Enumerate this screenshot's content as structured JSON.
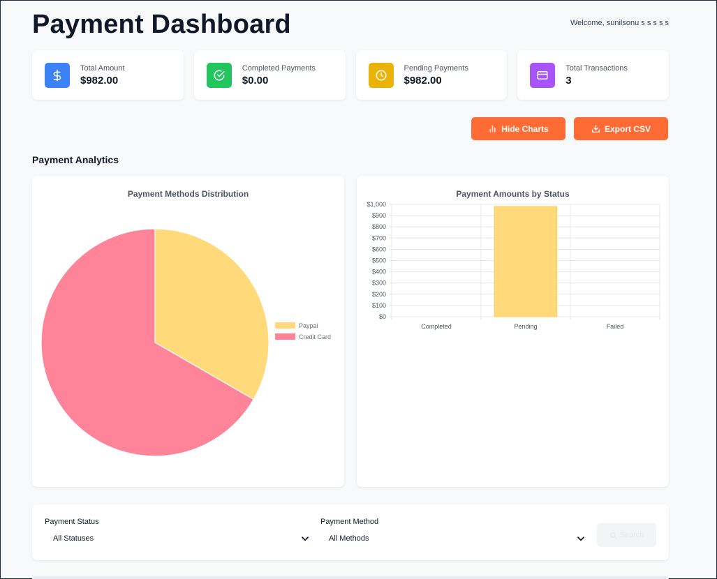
{
  "header": {
    "title": "Payment Dashboard",
    "welcome": "Welcome, sunilsonu s s s s s"
  },
  "stats": [
    {
      "label": "Total Amount",
      "value": "$982.00",
      "icon": "dollar-icon",
      "color": "#3b82f6"
    },
    {
      "label": "Completed Payments",
      "value": "$0.00",
      "icon": "check-circle-icon",
      "color": "#22c55e"
    },
    {
      "label": "Pending Payments",
      "value": "$982.00",
      "icon": "clock-icon",
      "color": "#eab308"
    },
    {
      "label": "Total Transactions",
      "value": "3",
      "icon": "credit-card-icon",
      "color": "#a855f7"
    }
  ],
  "actions": {
    "hide_charts": "Hide Charts",
    "export_csv": "Export CSV",
    "accent": "#ff6b35"
  },
  "analytics": {
    "title": "Payment Analytics"
  },
  "chart_data": [
    {
      "type": "pie",
      "title": "Payment Methods Distribution",
      "categories": [
        "Paypal",
        "Credit Card"
      ],
      "values": [
        1,
        2
      ],
      "colors": [
        "#ffd97a",
        "#ff8499"
      ],
      "legend": "right"
    },
    {
      "type": "bar",
      "title": "Payment Amounts by Status",
      "categories": [
        "Completed",
        "Pending",
        "Failed"
      ],
      "values": [
        0,
        982,
        0
      ],
      "ylim": [
        0,
        1000
      ],
      "yticks": [
        "$0",
        "$100",
        "$200",
        "$300",
        "$400",
        "$500",
        "$600",
        "$700",
        "$800",
        "$900",
        "$1,000"
      ],
      "color": "#ffd97a",
      "grid": true
    }
  ],
  "filters": {
    "status_label": "Payment Status",
    "status_value": "All Statuses",
    "method_label": "Payment Method",
    "method_value": "All Methods",
    "search_label": "Search"
  }
}
